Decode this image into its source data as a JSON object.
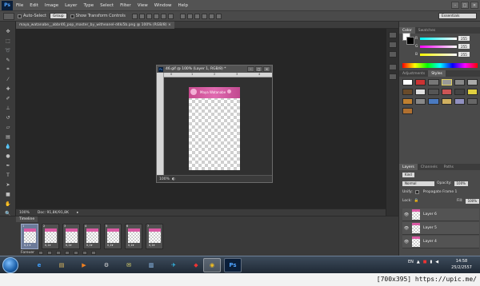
{
  "app": {
    "logo": "Ps"
  },
  "menu": [
    "File",
    "Edit",
    "Image",
    "Layer",
    "Type",
    "Select",
    "Filter",
    "View",
    "Window",
    "Help"
  ],
  "window_controls": [
    "-",
    "□",
    "×"
  ],
  "options": {
    "auto_select_label": "Auto-Select",
    "auto_select_value": "Group",
    "transform_label": "Show Transform Controls",
    "workspace": "Essentials"
  },
  "document_tab": "maya_watanabe__abbr46_pop_master_by_witheanel-d4ki5b.png @ 100% (RGB/8) ×",
  "doc_window": {
    "title": "46.gif @ 100% (Layer 1, RGB/8) *",
    "ruler_ticks": [
      "0",
      "1",
      "2",
      "3",
      "4"
    ],
    "banner_text": "Maya Watanabe",
    "zoom": "100%"
  },
  "status": {
    "zoom": "100%",
    "doc": "Doc: 91,8K/91,8K"
  },
  "timeline": {
    "tab": "Timeline",
    "loop": "Forever",
    "frames": [
      {
        "num": "1",
        "delay": "0,1 ▾",
        "selected": true
      },
      {
        "num": "2",
        "delay": "0,1▾",
        "selected": false
      },
      {
        "num": "3",
        "delay": "0,1▾",
        "selected": false
      },
      {
        "num": "4",
        "delay": "0,1▾",
        "selected": false
      },
      {
        "num": "5",
        "delay": "0,1▾",
        "selected": false
      },
      {
        "num": "6",
        "delay": "0,1▾",
        "selected": false
      },
      {
        "num": "7",
        "delay": "0,1▾",
        "selected": false
      }
    ]
  },
  "color_panel": {
    "tabs": [
      "Color",
      "Swatches"
    ],
    "r_label": "R",
    "r": "255",
    "g_label": "G",
    "g": "255",
    "b_label": "B",
    "b": "255"
  },
  "adjustments_panel": {
    "tabs": [
      "Adjustments",
      "Styles"
    ]
  },
  "layers_panel": {
    "tabs": [
      "Layers",
      "Channels",
      "Paths"
    ],
    "kind": "Kind",
    "blend": "Normal",
    "opacity_label": "Opacity:",
    "opacity": "100%",
    "unify_label": "Unify:",
    "propagate_label": "Propagate Frame 1",
    "lock_label": "Lock:",
    "fill_label": "Fill:",
    "fill": "100%",
    "layers": [
      "Layer 6",
      "Layer 5",
      "Layer 4"
    ]
  },
  "taskbar": {
    "apps": [
      "ie-icon",
      "folder-icon",
      "media-icon",
      "files-icon",
      "notes-icon",
      "fish-icon",
      "chrome-icon",
      "photoshop-icon"
    ],
    "lang": "EN",
    "time": "14:58",
    "date": "25/2/2557"
  },
  "watermark": "[700x395] https://upic.me/"
}
